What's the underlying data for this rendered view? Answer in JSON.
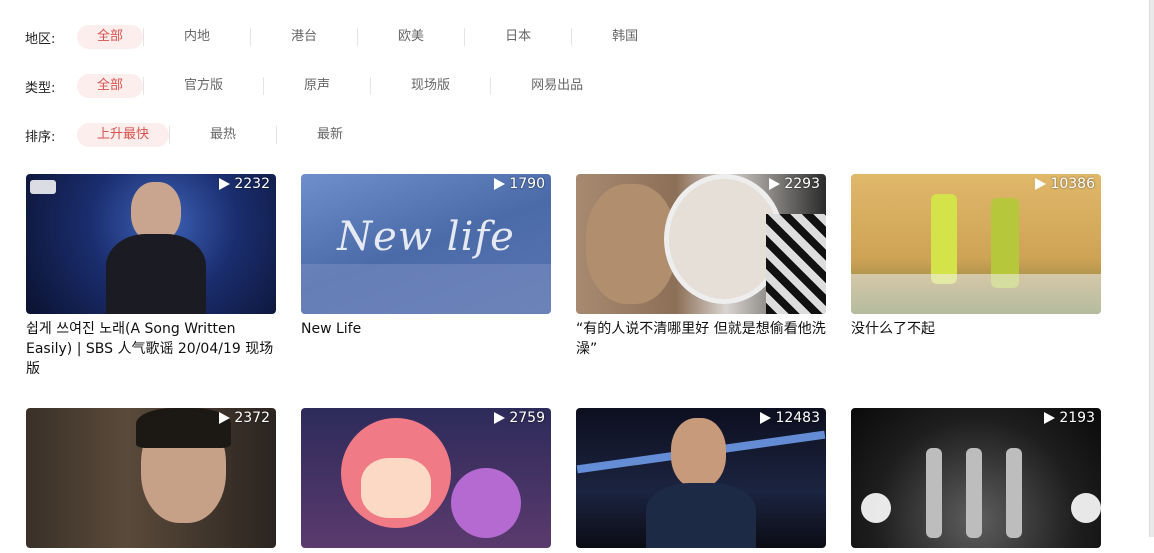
{
  "filters": [
    {
      "label": "地区:",
      "options": [
        "全部",
        "内地",
        "港台",
        "欧美",
        "日本",
        "韩国"
      ],
      "active": 0
    },
    {
      "label": "类型:",
      "options": [
        "全部",
        "官方版",
        "原声",
        "现场版",
        "网易出品"
      ],
      "active": 0
    },
    {
      "label": "排序:",
      "options": [
        "上升最快",
        "最热",
        "最新"
      ],
      "active": 0
    }
  ],
  "videos": [
    {
      "count": "2232",
      "title": "쉽게 쓰여진 노래(A Song Written Easily) | SBS 人气歌谣 20/04/19 现场版"
    },
    {
      "count": "1790",
      "title": "New Life",
      "overlay_text": "New life"
    },
    {
      "count": "2293",
      "title": "“有的人说不清哪里好 但就是想偷看他洗澡”"
    },
    {
      "count": "10386",
      "title": "没什么了不起"
    },
    {
      "count": "2372",
      "title": ""
    },
    {
      "count": "2759",
      "title": ""
    },
    {
      "count": "12483",
      "title": ""
    },
    {
      "count": "2193",
      "title": ""
    }
  ],
  "colors": {
    "accent": "#d9534f",
    "active_bg": "#fbeeec"
  }
}
